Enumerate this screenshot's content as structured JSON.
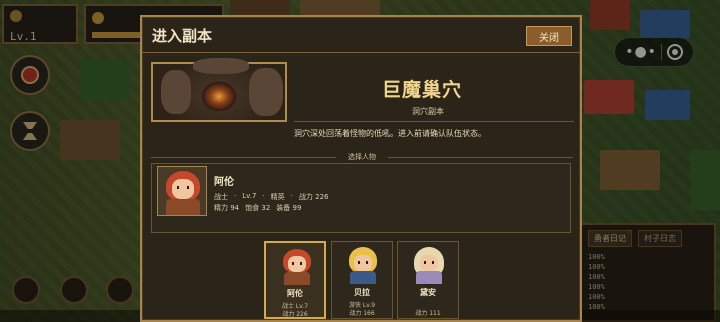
{
  "hud": {
    "player_tag": "",
    "level": "Lv.1",
    "resource_label": "",
    "side_buttons": [
      {
        "label": "",
        "icon": "red-emblem-icon"
      },
      {
        "label": "",
        "icon": "hourglass-icon"
      }
    ]
  },
  "modal": {
    "title": "进入副本",
    "close_label": "关闭",
    "dungeon_name": "巨魔巢穴",
    "dungeon_type": "洞穴副本",
    "dungeon_desc": "洞穴深处回荡着怪物的低吼。进入前请确认队伍状态。",
    "section_label": "选择人物",
    "selected_hero": {
      "name": "阿伦",
      "class": "战士",
      "level": "Lv.7",
      "rank": "精英",
      "power_label": "战力",
      "power": "226",
      "line2": [
        "精力 94",
        "饱食 32",
        "装备 99"
      ]
    },
    "party": [
      {
        "name": "阿伦",
        "class_level": "战士 Lv.7",
        "power": "战力 226",
        "selected": true,
        "hair": "#c4482a",
        "outfit": "#8a4a2a"
      },
      {
        "name": "贝拉",
        "class_level": "游侠 Lv.9",
        "power": "战力 166",
        "selected": false,
        "hair": "#e8c04a",
        "outfit": "#3a5a8a"
      },
      {
        "name": "黛安",
        "class_level": "",
        "power": "战力 111",
        "selected": false,
        "hair": "#e8d8b0",
        "outfit": "#9a8ab8"
      }
    ]
  },
  "log": {
    "tabs": [
      "勇者日记",
      "村子日志"
    ],
    "rows": [
      {
        "pct": "100%",
        "text": ""
      },
      {
        "pct": "100%",
        "text": ""
      },
      {
        "pct": "100%",
        "text": ""
      },
      {
        "pct": "100%",
        "text": ""
      },
      {
        "pct": "100%",
        "text": ""
      },
      {
        "pct": "100%",
        "text": ""
      }
    ]
  },
  "bottom_nav": [
    "",
    "",
    "",
    "",
    "",
    "",
    "",
    "",
    "",
    "",
    ""
  ],
  "colors": {
    "accent": "#a5854d",
    "title": "#f1d58c",
    "button": "#8a5e2c"
  }
}
